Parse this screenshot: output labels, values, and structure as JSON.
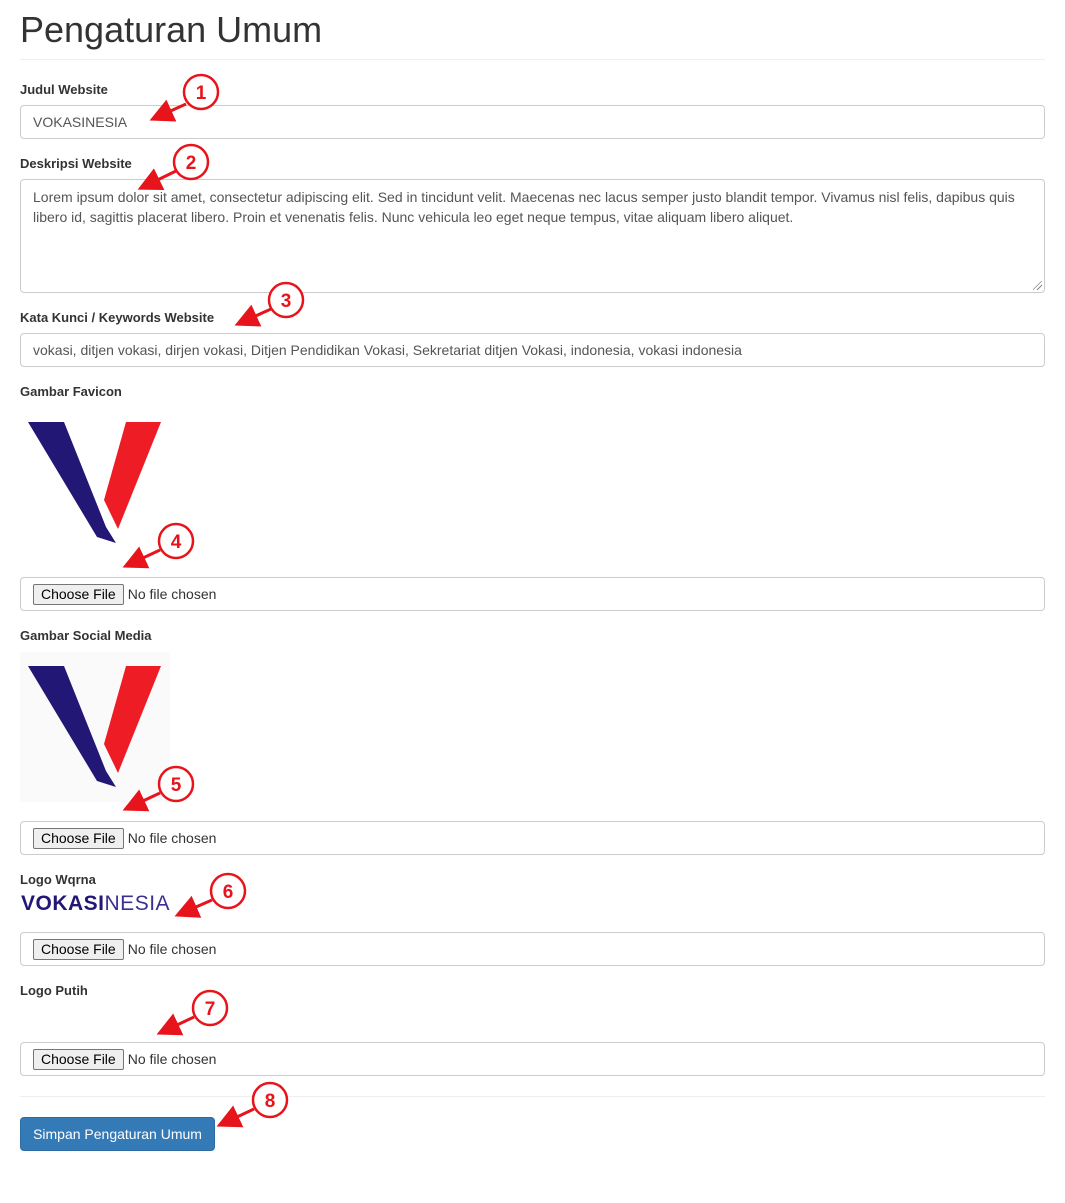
{
  "page": {
    "title": "Pengaturan Umum"
  },
  "form": {
    "judul": {
      "label": "Judul Website",
      "value": "VOKASINESIA"
    },
    "deskripsi": {
      "label": "Deskripsi Website",
      "value": "Lorem ipsum dolor sit amet, consectetur adipiscing elit. Sed in tincidunt velit. Maecenas nec lacus semper justo blandit tempor. Vivamus nisl felis, dapibus quis libero id, sagittis placerat libero. Proin et venenatis felis. Nunc vehicula leo eget neque tempus, vitae aliquam libero aliquet."
    },
    "keywords": {
      "label": "Kata Kunci / Keywords Website",
      "value": "vokasi, ditjen vokasi, dirjen vokasi, Ditjen Pendidikan Vokasi, Sekretariat ditjen Vokasi, indonesia, vokasi indonesia"
    },
    "favicon": {
      "label": "Gambar Favicon",
      "button": "Choose File",
      "status": "No file chosen",
      "preview_icon": "vokasi-v-logo"
    },
    "social": {
      "label": "Gambar Social Media",
      "button": "Choose File",
      "status": "No file chosen",
      "preview_icon": "vokasi-v-logo"
    },
    "logo_warna": {
      "label": "Logo Wqrna",
      "button": "Choose File",
      "status": "No file chosen",
      "preview_strong": "VOKASI",
      "preview_light": "NESIA"
    },
    "logo_putih": {
      "label": "Logo Putih",
      "button": "Choose File",
      "status": "No file chosen"
    },
    "submit_label": "Simpan Pengaturan Umum"
  },
  "annotations": [
    "1",
    "2",
    "3",
    "4",
    "5",
    "6",
    "7",
    "8"
  ],
  "colors": {
    "annotation": "#e8141b",
    "logo_navy": "#221775",
    "logo_red": "#ee1c25",
    "primary_button": "#337ab7"
  }
}
